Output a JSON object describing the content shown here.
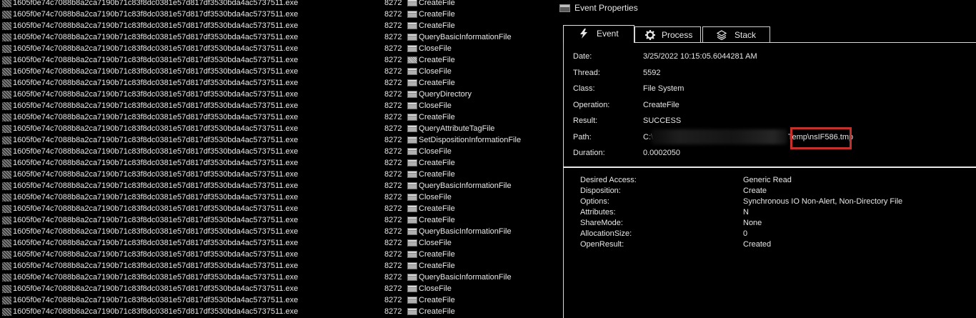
{
  "event_list": {
    "process_name": "1605f0e74c7088b8a2ca7190b71c83f8dc0381e57d817df3530bda4ac5737511.exe",
    "pid": "8272",
    "rows": [
      {
        "operation": "CreateFile",
        "icon": "normal"
      },
      {
        "operation": "CreateFile",
        "icon": "normal"
      },
      {
        "operation": "CreateFile",
        "icon": "normal"
      },
      {
        "operation": "QueryBasicInformationFile",
        "icon": "normal"
      },
      {
        "operation": "CloseFile",
        "icon": "normal"
      },
      {
        "operation": "CreateFile",
        "icon": "alt"
      },
      {
        "operation": "CloseFile",
        "icon": "normal"
      },
      {
        "operation": "CreateFile",
        "icon": "normal"
      },
      {
        "operation": "QueryDirectory",
        "icon": "normal"
      },
      {
        "operation": "CloseFile",
        "icon": "normal"
      },
      {
        "operation": "CreateFile",
        "icon": "normal"
      },
      {
        "operation": "QueryAttributeTagFile",
        "icon": "normal"
      },
      {
        "operation": "SetDispositionInformationFile",
        "icon": "normal"
      },
      {
        "operation": "CloseFile",
        "icon": "normal"
      },
      {
        "operation": "CreateFile",
        "icon": "normal"
      },
      {
        "operation": "CreateFile",
        "icon": "normal"
      },
      {
        "operation": "QueryBasicInformationFile",
        "icon": "normal"
      },
      {
        "operation": "CloseFile",
        "icon": "normal"
      },
      {
        "operation": "CreateFile",
        "icon": "normal"
      },
      {
        "operation": "CreateFile",
        "icon": "normal"
      },
      {
        "operation": "QueryBasicInformationFile",
        "icon": "normal"
      },
      {
        "operation": "CloseFile",
        "icon": "normal"
      },
      {
        "operation": "CreateFile",
        "icon": "normal"
      },
      {
        "operation": "CreateFile",
        "icon": "normal"
      },
      {
        "operation": "QueryBasicInformationFile",
        "icon": "normal"
      },
      {
        "operation": "CloseFile",
        "icon": "normal"
      },
      {
        "operation": "CreateFile",
        "icon": "normal"
      },
      {
        "operation": "CreateFile",
        "icon": "normal"
      }
    ]
  },
  "properties": {
    "window_title": "Event Properties",
    "tabs": [
      {
        "label": "Event",
        "icon": "lightning-icon",
        "active": true
      },
      {
        "label": "Process",
        "icon": "gear-icon",
        "active": false
      },
      {
        "label": "Stack",
        "icon": "stack-icon",
        "active": false
      }
    ],
    "fields": {
      "date_label": "Date:",
      "date": "3/25/2022 10:15:05.6044281 AM",
      "thread_label": "Thread:",
      "thread": "5592",
      "class_label": "Class:",
      "class": "File System",
      "operation_label": "Operation:",
      "operation": "CreateFile",
      "result_label": "Result:",
      "result": "SUCCESS",
      "path_label": "Path:",
      "path_prefix": "C:\\",
      "path_suffix": "Temp\\nsIF586.tmp",
      "duration_label": "Duration:",
      "duration": "0.0002050"
    },
    "details": [
      {
        "label": "Desired Access:",
        "value": "Generic Read"
      },
      {
        "label": "Disposition:",
        "value": "Create"
      },
      {
        "label": "Options:",
        "value": "Synchronous IO Non-Alert, Non-Directory File"
      },
      {
        "label": "Attributes:",
        "value": "N"
      },
      {
        "label": "ShareMode:",
        "value": "None"
      },
      {
        "label": "AllocationSize:",
        "value": "0"
      },
      {
        "label": "OpenResult:",
        "value": "Created"
      }
    ]
  },
  "colors": {
    "highlight": "#c4302b",
    "background": "#000000",
    "text": "#e6e6e6"
  }
}
